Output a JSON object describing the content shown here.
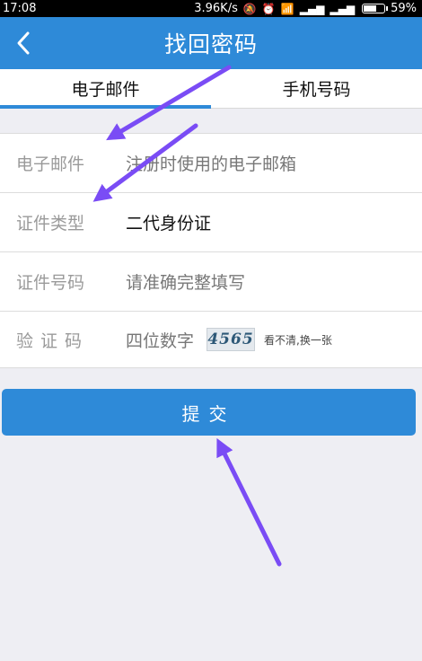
{
  "status_bar": {
    "time": "17:08",
    "net_speed": "3.96K/s",
    "battery": "59%"
  },
  "header": {
    "title": "找回密码"
  },
  "tabs": [
    {
      "label": "电子邮件",
      "active": true
    },
    {
      "label": "手机号码",
      "active": false
    }
  ],
  "form": {
    "email": {
      "label": "电子邮件",
      "placeholder": "注册时使用的电子邮箱"
    },
    "id_type": {
      "label": "证件类型",
      "value": "二代身份证"
    },
    "id_number": {
      "label": "证件号码",
      "placeholder": "请准确完整填写"
    },
    "captcha": {
      "label": "验证码",
      "placeholder": "四位数字",
      "image_text": "4565",
      "refresh_text": "看不清,换一张"
    }
  },
  "submit_label": "提交",
  "colors": {
    "accent": "#2e8ad8",
    "annotation_arrow": "#7a4cf5"
  }
}
